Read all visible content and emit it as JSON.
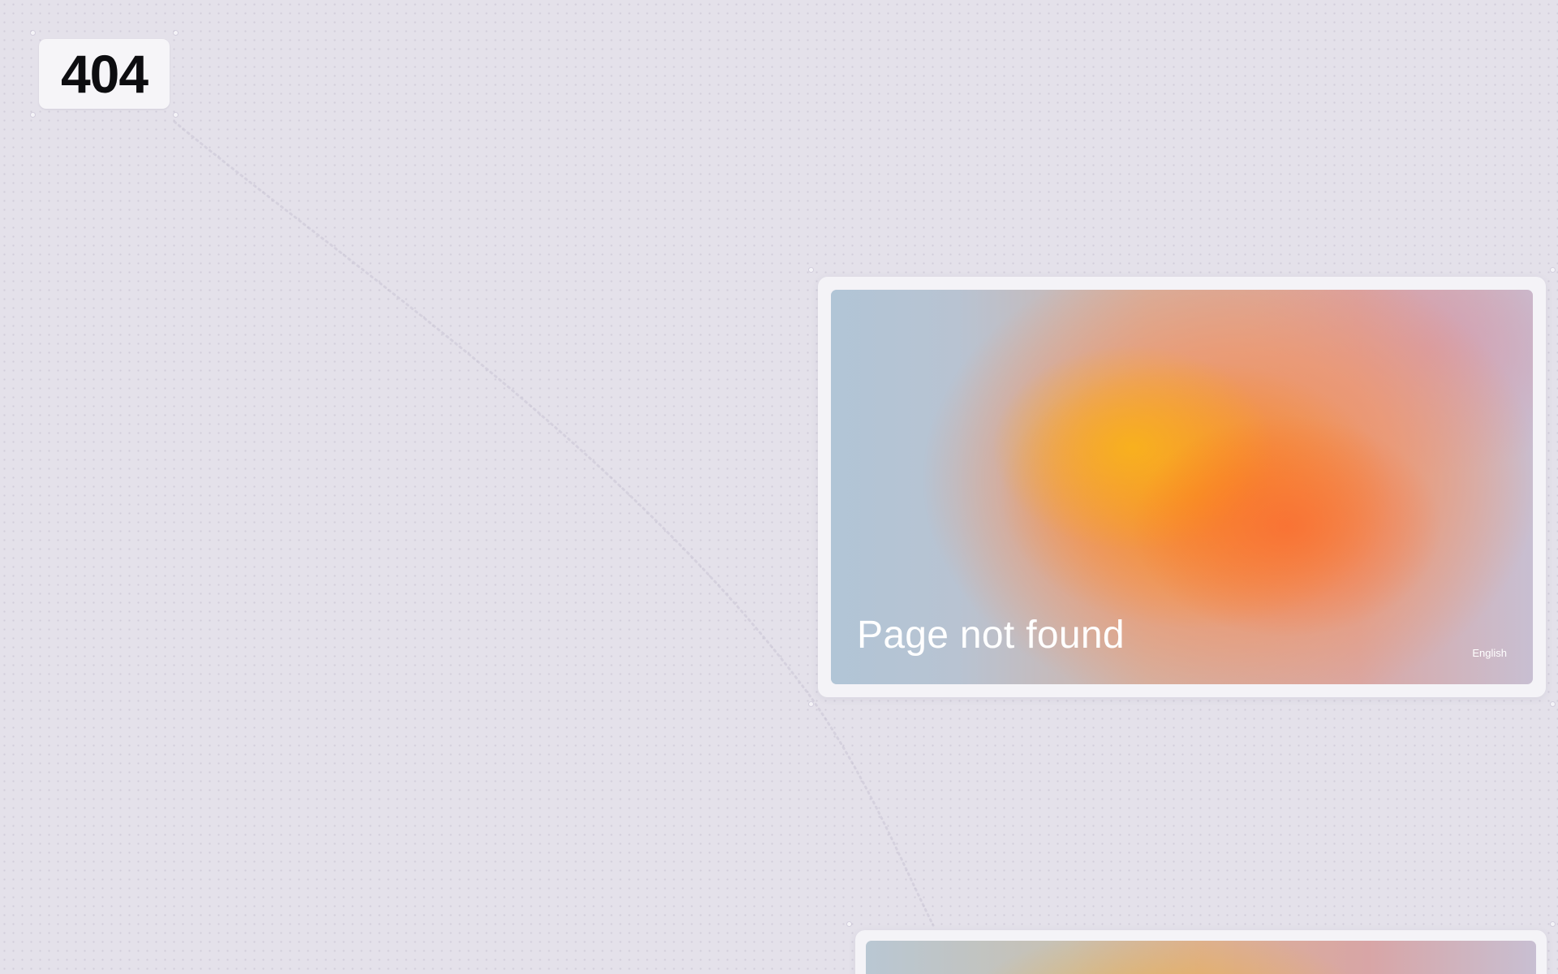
{
  "canvas": {
    "badge": {
      "text": "404"
    },
    "card": {
      "title": "Page not found",
      "language_label": "English"
    },
    "next_card": {
      "title": ""
    }
  },
  "colors": {
    "canvas_background": "#e4e1ea",
    "card_background": "#f4f3f7",
    "gradient_blue": "#b1c6d6",
    "gradient_yellow": "#f8b21c",
    "gradient_orange": "#fa6e32",
    "gradient_pink": "#d696aa",
    "title_text": "#ffffff",
    "badge_text": "#0d0d10"
  }
}
